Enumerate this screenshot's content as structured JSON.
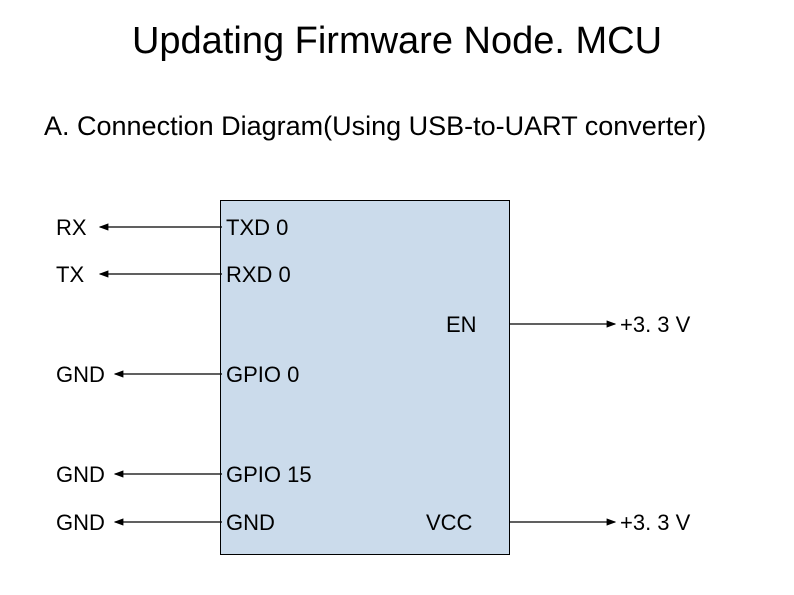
{
  "title": "Updating Firmware Node. MCU",
  "subtitle": "A. Connection Diagram(Using USB-to-UART converter)",
  "leftLabels": {
    "rx": "RX",
    "tx": "TX",
    "gnd1": "GND",
    "gnd2": "GND",
    "gnd3": "GND"
  },
  "boxLabels": {
    "txd0": "TXD 0",
    "rxd0": "RXD 0",
    "en": "EN",
    "gpio0": "GPIO 0",
    "gpio15": "GPIO 15",
    "gnd": "GND",
    "vcc": "VCC"
  },
  "rightLabels": {
    "v33a": "+3. 3 V",
    "v33b": "+3. 3 V"
  }
}
